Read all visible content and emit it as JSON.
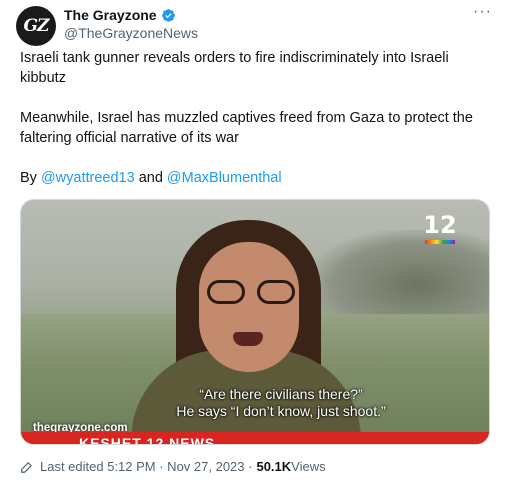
{
  "account": {
    "display_name": "The Grayzone",
    "handle": "@TheGrayzoneNews",
    "avatar_text": "GZ",
    "verified": true
  },
  "more_label": "···",
  "tweet": {
    "paragraph1": "Israeli tank gunner reveals orders to fire indiscriminately into Israeli kibbutz",
    "paragraph2": "Meanwhile, Israel has muzzled captives freed from Gaza to protect the faltering official narrative of its war",
    "by_prefix": "By ",
    "mention1": "@wyattreed13",
    "and_word": " and ",
    "mention2": "@MaxBlumenthal"
  },
  "media": {
    "channel_number": "12",
    "subtitle_line1": "“Are there civilians there?”",
    "subtitle_line2": "He says “I don’t know, just shoot.”",
    "watermark": "thegrayzone.com",
    "news_bar_text": "KESHET 12 NEWS"
  },
  "meta": {
    "edited_label": "Last edited 5:12 PM · Nov 27, 2023 ·",
    "views_count": "50.1K",
    "views_label": " Views"
  },
  "colors": {
    "link": "#1d9bf0",
    "secondary_text": "#536471",
    "verified_badge": "#1d9bf0",
    "news_bar": "#d9251f"
  }
}
